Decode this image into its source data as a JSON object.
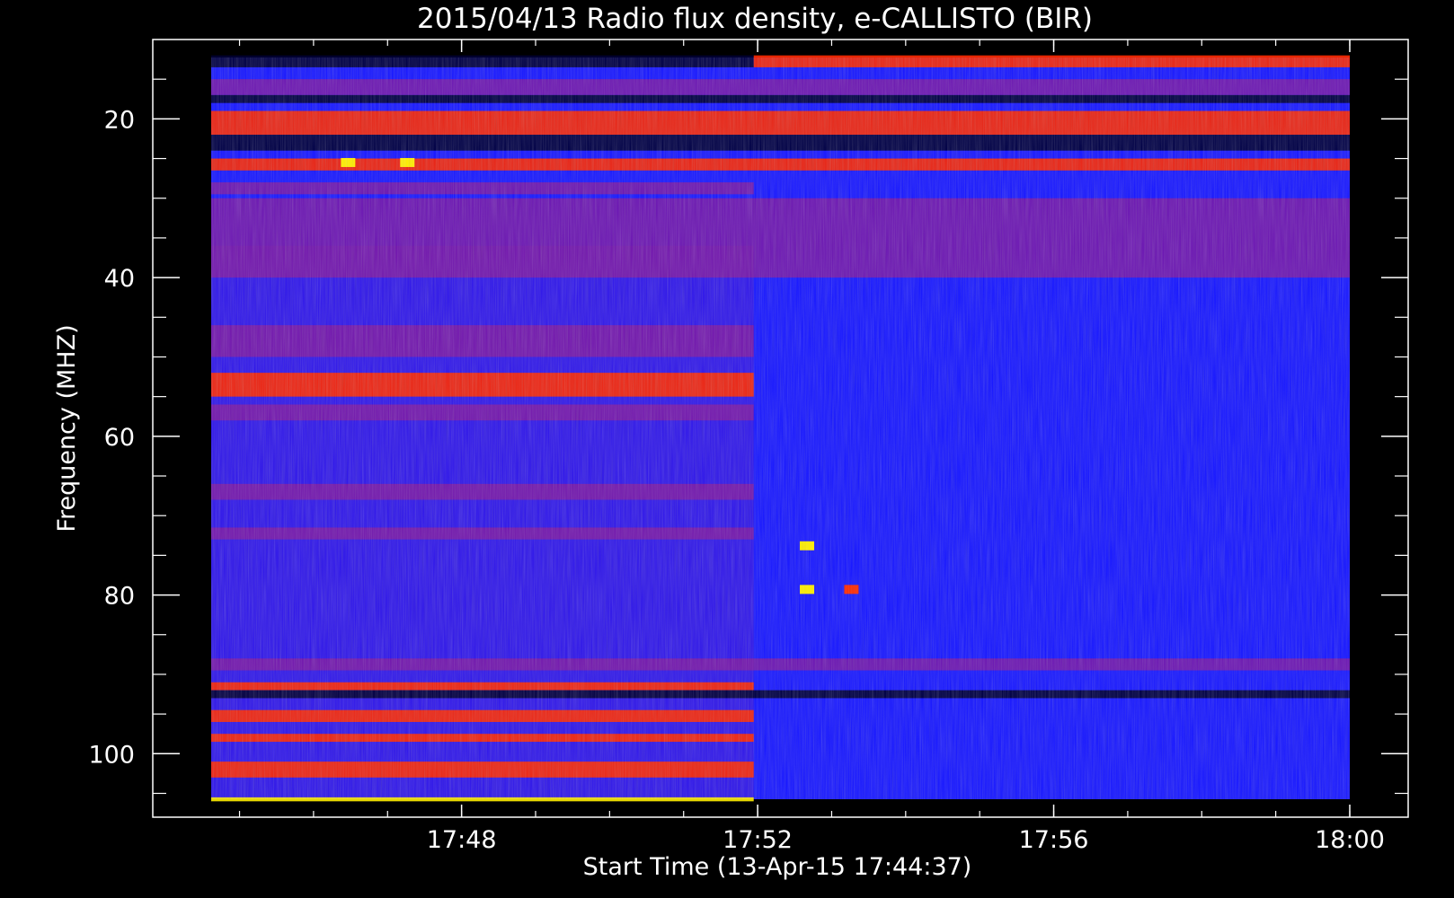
{
  "chart_data": {
    "type": "heatmap",
    "title": "2015/04/13  Radio flux density, e-CALLISTO (BIR)",
    "xlabel": "Start Time (13-Apr-15 17:44:37)",
    "ylabel": "Frequency (MHZ)",
    "x_tick_labels": [
      "17:48",
      "17:52",
      "17:56",
      "18:00"
    ],
    "x_tick_minutes": [
      3.383,
      7.383,
      11.383,
      15.383
    ],
    "x_data_range_minutes": [
      0,
      15.383
    ],
    "x_split_minute": 7.33,
    "y_tick_labels": [
      "20",
      "40",
      "60",
      "80",
      "100"
    ],
    "y_ticks": [
      20,
      40,
      60,
      80,
      100
    ],
    "y_minor_ticks": [
      15,
      25,
      30,
      35,
      45,
      50,
      55,
      65,
      70,
      75,
      85,
      90,
      95,
      105
    ],
    "ylim": [
      10,
      108
    ],
    "y_inverted": true,
    "grid": false,
    "colors": {
      "background": "#000000",
      "base": "#1a1aff",
      "low": "#0000cc",
      "medium": "#8a1a9a",
      "high": "#ff2a00",
      "peak": "#ffee00",
      "dark_band": "#000033",
      "axes": "#ffffff"
    },
    "bands": [
      {
        "freq": [
          12,
          13.5
        ],
        "minutes": [
          0,
          7.33
        ],
        "level": "dark"
      },
      {
        "freq": [
          12,
          13.5
        ],
        "minutes": [
          7.33,
          15.383
        ],
        "level": "high"
      },
      {
        "freq": [
          15,
          17
        ],
        "minutes": [
          0,
          15.383
        ],
        "level": "medium"
      },
      {
        "freq": [
          17,
          18
        ],
        "minutes": [
          0,
          15.383
        ],
        "level": "dark"
      },
      {
        "freq": [
          19,
          22
        ],
        "minutes": [
          0,
          15.383
        ],
        "level": "high"
      },
      {
        "freq": [
          22,
          24
        ],
        "minutes": [
          0,
          15.383
        ],
        "level": "dark"
      },
      {
        "freq": [
          25,
          26.5
        ],
        "minutes": [
          0,
          15.383
        ],
        "level": "high"
      },
      {
        "freq": [
          28,
          29.5
        ],
        "minutes": [
          0,
          7.33
        ],
        "level": "medium"
      },
      {
        "freq": [
          30,
          40
        ],
        "minutes": [
          0,
          15.383
        ],
        "level": "medium"
      },
      {
        "freq": [
          46,
          50
        ],
        "minutes": [
          0,
          7.33
        ],
        "level": "medium"
      },
      {
        "freq": [
          52,
          55
        ],
        "minutes": [
          0,
          7.33
        ],
        "level": "high"
      },
      {
        "freq": [
          56,
          58
        ],
        "minutes": [
          0,
          7.33
        ],
        "level": "medium"
      },
      {
        "freq": [
          66,
          68
        ],
        "minutes": [
          0,
          7.33
        ],
        "level": "medium"
      },
      {
        "freq": [
          71.5,
          73
        ],
        "minutes": [
          0,
          7.33
        ],
        "level": "medium"
      },
      {
        "freq": [
          88,
          89.5
        ],
        "minutes": [
          0,
          15.383
        ],
        "level": "medium"
      },
      {
        "freq": [
          91,
          92
        ],
        "minutes": [
          0,
          7.33
        ],
        "level": "high"
      },
      {
        "freq": [
          92,
          93
        ],
        "minutes": [
          0,
          15.383
        ],
        "level": "dark"
      },
      {
        "freq": [
          94.5,
          96
        ],
        "minutes": [
          0,
          7.33
        ],
        "level": "high"
      },
      {
        "freq": [
          97.5,
          98.5
        ],
        "minutes": [
          0,
          7.33
        ],
        "level": "high"
      },
      {
        "freq": [
          101,
          103
        ],
        "minutes": [
          0,
          7.33
        ],
        "level": "high"
      },
      {
        "freq": [
          105.5,
          106
        ],
        "minutes": [
          0,
          7.33
        ],
        "level": "peak"
      }
    ],
    "spots": [
      {
        "minute": 2.65,
        "freq": 25.5,
        "level": "peak"
      },
      {
        "minute": 1.85,
        "freq": 25.5,
        "level": "peak"
      },
      {
        "minute": 8.05,
        "freq": 73.8,
        "level": "peak"
      },
      {
        "minute": 8.05,
        "freq": 79.3,
        "level": "peak"
      },
      {
        "minute": 8.65,
        "freq": 79.3,
        "level": "high"
      }
    ]
  }
}
